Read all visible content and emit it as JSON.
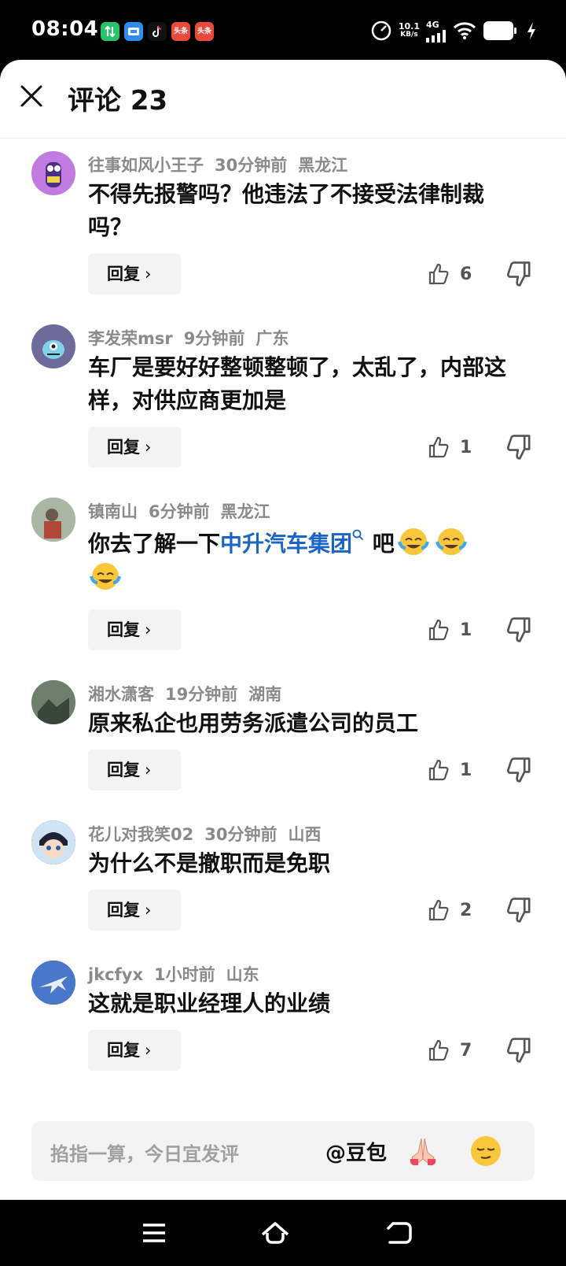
{
  "status_bar": {
    "time": "08:04",
    "net_speed_value": "10.1",
    "net_speed_unit": "KB/s",
    "network_type": "4G",
    "notifications": [
      {
        "icon": "green-app-icon",
        "label": "",
        "color": "#27c46b"
      },
      {
        "icon": "blue-app-icon",
        "label": "",
        "color": "#2d8cf0"
      },
      {
        "icon": "tiktok-icon",
        "label": "",
        "color": "#111111"
      },
      {
        "icon": "toutiao-icon",
        "label": "头条",
        "color": "#e84a3c"
      },
      {
        "icon": "toutiao-icon",
        "label": "头条",
        "color": "#e84a3c"
      }
    ]
  },
  "header": {
    "title": "评论 23"
  },
  "comments": [
    {
      "user": "往事如风小王子",
      "time": "30分钟前",
      "location": "黑龙江",
      "text": "不得先报警吗？他违法了不接受法律制裁吗？",
      "reply_label": "回复",
      "likes": "6",
      "avatar_color": "#c27be0"
    },
    {
      "user": "李发荣msr",
      "time": "9分钟前",
      "location": "广东",
      "text": "车厂是要好好整顿整顿了，太乱了，内部这样，对供应商更加是",
      "reply_label": "回复",
      "likes": "1",
      "avatar_color": "#6e6a9a"
    },
    {
      "user": "镇南山",
      "time": "6分钟前",
      "location": "黑龙江",
      "text_before": "你去了解一下",
      "link_text": "中升汽车集团",
      "text_after": " 吧",
      "reply_label": "回复",
      "likes": "1",
      "avatar_color": "#8c9a84"
    },
    {
      "user": "湘水潇客",
      "time": "19分钟前",
      "location": "湖南",
      "text": "原来私企也用劳务派遣公司的员工",
      "reply_label": "回复",
      "likes": "1",
      "avatar_color": "#4d5c4e"
    },
    {
      "user": "花儿对我笑02",
      "time": "30分钟前",
      "location": "山西",
      "text": "为什么不是撤职而是免职",
      "reply_label": "回复",
      "likes": "2",
      "avatar_color": "#2b3450"
    },
    {
      "user": "jkcfyx",
      "time": "1小时前",
      "location": "山东",
      "text": "这就是职业经理人的业绩",
      "reply_label": "回复",
      "likes": "7",
      "avatar_color": "#3a64b4"
    }
  ],
  "input_bar": {
    "placeholder": "掐指一算，今日宜发评",
    "mention": "@豆包"
  }
}
